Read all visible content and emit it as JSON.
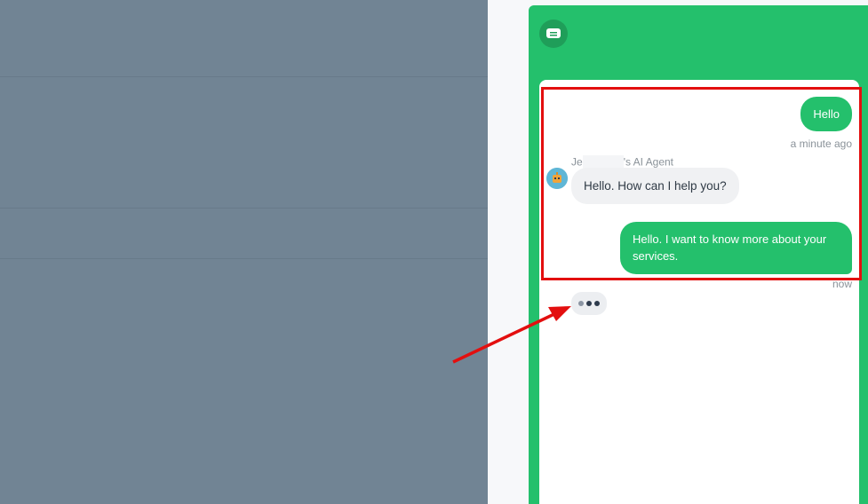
{
  "chat": {
    "messages": [
      {
        "role": "user",
        "text": "Hello",
        "time": "a minute ago"
      },
      {
        "role": "agent",
        "sender_prefix": "Je",
        "sender_suffix": "'s AI Agent",
        "text": "Hello. How can I help you?"
      },
      {
        "role": "user",
        "text": "Hello. I want to know more about your services.",
        "time": "now"
      }
    ]
  },
  "colors": {
    "brand": "#24c06c",
    "overlay": "#718494",
    "annotation": "#e30f0f"
  },
  "icons": {
    "logo": "chat-bubble-icon",
    "avatar": "robot-avatar-icon",
    "typing": "typing-indicator-icon"
  }
}
